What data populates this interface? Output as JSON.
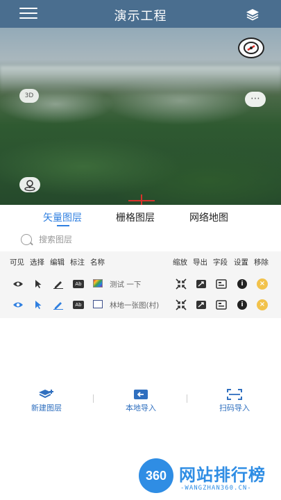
{
  "header": {
    "title": "演示工程",
    "menu_icon": "menu-icon",
    "layers_icon": "layers-icon"
  },
  "map": {
    "badge_3d": "3D",
    "more": "⋯"
  },
  "tabs": [
    {
      "label": "矢量图层",
      "active": true
    },
    {
      "label": "栅格图层",
      "active": false
    },
    {
      "label": "网络地图",
      "active": false
    }
  ],
  "search": {
    "placeholder": "搜索图层"
  },
  "columns_left": [
    "可见",
    "选择",
    "编辑",
    "标注",
    "名称"
  ],
  "columns_right": [
    "缩放",
    "导出",
    "字段",
    "设置",
    "移除"
  ],
  "layers": [
    {
      "name": "测试 一下",
      "visible_color": "#333333",
      "swatch": "gradient"
    },
    {
      "name": "林地一张图(村)",
      "visible_color": "#2f7fe0",
      "swatch": "outline"
    }
  ],
  "icons": {
    "ab": "Ab",
    "info": "i",
    "remove": "×"
  },
  "actions": [
    {
      "label": "新建图层",
      "icon": "new-layer-icon"
    },
    {
      "label": "本地导入",
      "icon": "import-icon"
    },
    {
      "label": "扫码导入",
      "icon": "scan-icon"
    }
  ],
  "watermark": {
    "badge": "360",
    "name": "网站排行榜",
    "url": "-WANGZHAN360.CN-"
  },
  "colors": {
    "accent": "#2f7fe0",
    "header": "#4a6e8f",
    "remove": "#f2c24b"
  }
}
